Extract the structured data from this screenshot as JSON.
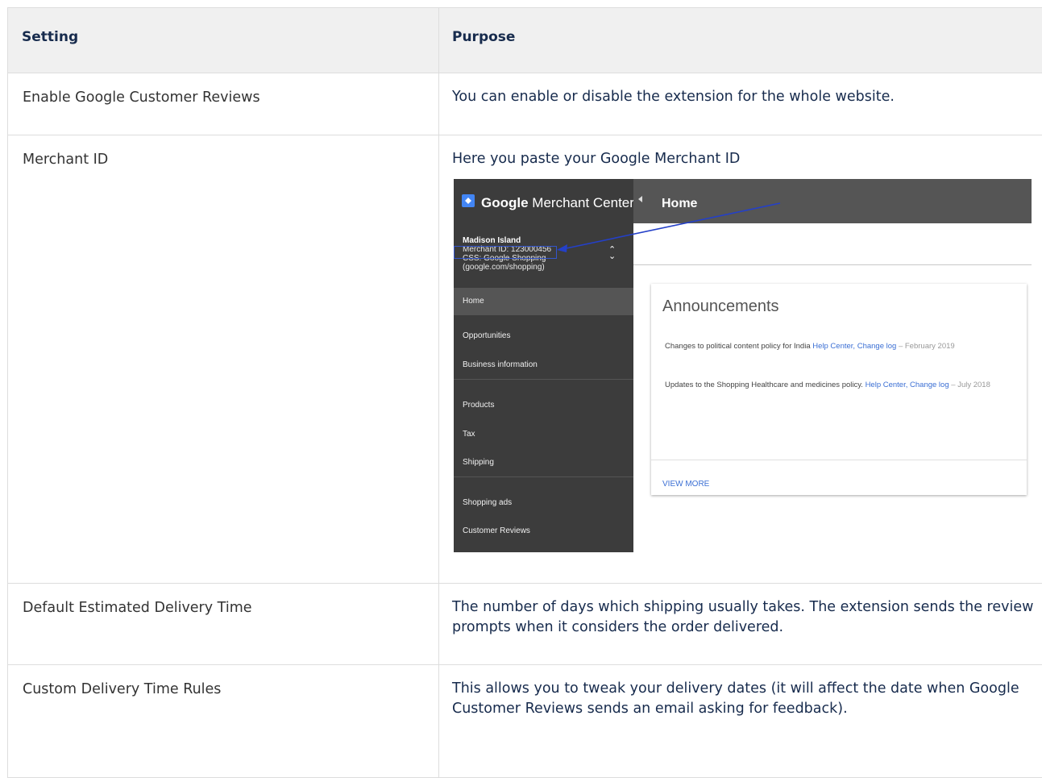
{
  "table": {
    "headers": {
      "setting": "Setting",
      "purpose": "Purpose"
    },
    "rows": [
      {
        "setting": "Enable Google Customer Reviews",
        "purpose": "You can enable or disable the extension for the whole website."
      },
      {
        "setting": "Merchant ID",
        "purpose": "Here you paste your Google Merchant ID"
      },
      {
        "setting": "Default Estimated Delivery Time",
        "purpose": "The number of days which shipping usually takes. The extension sends the review prompts when it considers the order delivered."
      },
      {
        "setting": "Custom Delivery Time Rules",
        "purpose": "This allows you to tweak your delivery dates (it will affect the date when Google Customer Reviews sends an email asking for feedback)."
      }
    ]
  },
  "merchant_screenshot": {
    "brand_google": "Google",
    "brand_product": "Merchant Center",
    "page_title": "Home",
    "account": {
      "name": "Madison Island",
      "merchant_id": "Merchant ID: 123000456",
      "css_line1": "CSS: Google Shopping",
      "css_line2": "(google.com/shopping)"
    },
    "nav": {
      "home": "Home",
      "opportunities": "Opportunities",
      "business_information": "Business information",
      "products": "Products",
      "tax": "Tax",
      "shipping": "Shipping",
      "shopping_ads": "Shopping ads",
      "customer_reviews": "Customer Reviews"
    },
    "card": {
      "title": "Announcements",
      "ann1_text": "Changes to political content policy for India",
      "ann1_link1": "Help Center,",
      "ann1_link2": "Change log",
      "ann1_date": "– February 2019",
      "ann2_text": "Updates to the Shopping Healthcare and medicines policy.",
      "ann2_link1": "Help Center,",
      "ann2_link2": "Change log",
      "ann2_date": "– July 2018",
      "view_more": "VIEW MORE"
    },
    "colors": {
      "sidebar": "#3c3c3c",
      "topbar": "#555555",
      "link": "#3b6fd4",
      "arrow": "#2440c8"
    }
  }
}
